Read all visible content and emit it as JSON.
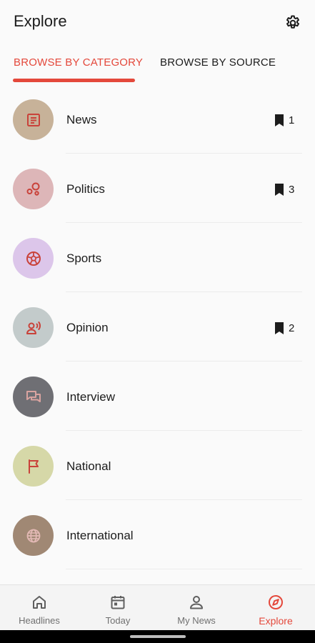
{
  "header": {
    "title": "Explore"
  },
  "tabs": [
    {
      "label": "BROWSE BY CATEGORY",
      "active": true
    },
    {
      "label": "BROWSE BY SOURCE",
      "active": false
    }
  ],
  "categories": [
    {
      "label": "News",
      "saved_count": "1",
      "circle_color": "#c7b299",
      "icon": "newspaper-icon"
    },
    {
      "label": "Politics",
      "saved_count": "3",
      "circle_color": "#ddb6b8",
      "icon": "bubbles-icon"
    },
    {
      "label": "Sports",
      "saved_count": null,
      "circle_color": "#dcc6ea",
      "icon": "soccer-ball-icon"
    },
    {
      "label": "Opinion",
      "saved_count": "2",
      "circle_color": "#c3cbcb",
      "icon": "speaker-person-icon"
    },
    {
      "label": "Interview",
      "saved_count": null,
      "circle_color": "#6f6f74",
      "icon": "chat-bubbles-icon"
    },
    {
      "label": "National",
      "saved_count": null,
      "circle_color": "#d6d8a8",
      "icon": "flag-icon"
    },
    {
      "label": "International",
      "saved_count": null,
      "circle_color": "#a08874",
      "icon": "globe-icon"
    }
  ],
  "bottom_nav": [
    {
      "label": "Headlines",
      "icon": "home-icon",
      "active": false
    },
    {
      "label": "Today",
      "icon": "calendar-icon",
      "active": false
    },
    {
      "label": "My News",
      "icon": "person-icon",
      "active": false
    },
    {
      "label": "Explore",
      "icon": "compass-icon",
      "active": true
    }
  ],
  "colors": {
    "accent": "#e4483b",
    "icon_red": "#c9423a"
  }
}
